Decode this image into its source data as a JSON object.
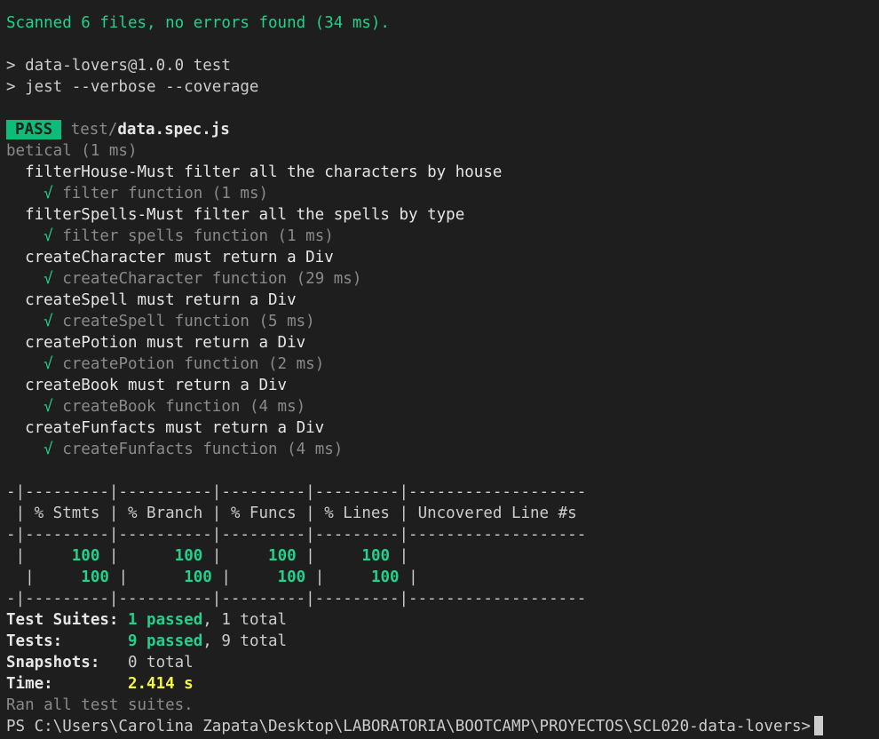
{
  "scan": "Scanned 6 files, no errors found (34 ms).",
  "npm": {
    "line1": "> data-lovers@1.0.0 test",
    "line2": "> jest --verbose --coverage"
  },
  "result": {
    "badge": "PASS",
    "path_dir": "test/",
    "path_file": "data.spec.js",
    "group": "betical (1 ms)"
  },
  "tests": [
    {
      "describe": "  filterHouse-Must filter all the characters by house",
      "check": "    √",
      "name": " filter function (1 ms)"
    },
    {
      "describe": "  filterSpells-Must filter all the spells by type",
      "check": "    √",
      "name": " filter spells function (1 ms)"
    },
    {
      "describe": "  createCharacter must return a Div",
      "check": "    √",
      "name": " createCharacter function (29 ms)"
    },
    {
      "describe": "  createSpell must return a Div",
      "check": "    √",
      "name": " createSpell function (5 ms)"
    },
    {
      "describe": "  createPotion must return a Div",
      "check": "    √",
      "name": " createPotion function (2 ms)"
    },
    {
      "describe": "  createBook must return a Div",
      "check": "    √",
      "name": " createBook function (4 ms)"
    },
    {
      "describe": "  createFunfacts must return a Div",
      "check": "    √",
      "name": " createFunfacts function (4 ms)"
    }
  ],
  "coverage": {
    "sep": "-|---------|----------|---------|---------|-------------------",
    "header": " | % Stmts | % Branch | % Funcs | % Lines | Uncovered Line #s",
    "row1": {
      "c0": " |     ",
      "v1": "100",
      "c1": " |      ",
      "v2": "100",
      "c2": " |     ",
      "v3": "100",
      "c3": " |     ",
      "v4": "100",
      "c4": " |"
    },
    "row2": {
      "c0": "  |     ",
      "v1": "100",
      "c1": " |      ",
      "v2": "100",
      "c2": " |     ",
      "v3": "100",
      "c3": " |     ",
      "v4": "100",
      "c4": " |"
    }
  },
  "summary": {
    "suites_label": "Test Suites: ",
    "suites_passed": "1 passed",
    "suites_total": ", 1 total",
    "tests_label": "Tests:       ",
    "tests_passed": "9 passed",
    "tests_total": ", 9 total",
    "snap_label": "Snapshots:   ",
    "snap_value": "0 total",
    "time_label": "Time:        ",
    "time_value": "2.414 s",
    "ran": "Ran all test suites."
  },
  "prompt": "PS C:\\Users\\Carolina Zapata\\Desktop\\LABORATORIA\\BOOTCAMP\\PROYECTOS\\SCL020-data-lovers>",
  "colors": {
    "background": "#1e1e1e",
    "green": "#23d18b",
    "badge": "#0dbc79",
    "gray": "#8a8a8a",
    "yellow": "#f5f543"
  }
}
